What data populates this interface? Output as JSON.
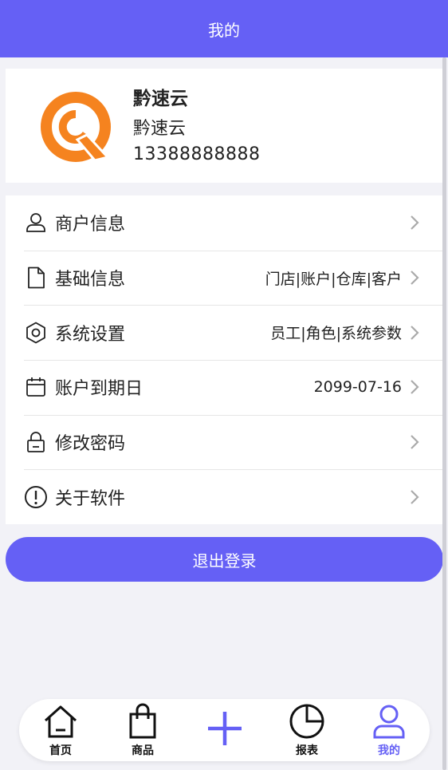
{
  "header": {
    "title": "我的"
  },
  "profile": {
    "name": "黔速云",
    "store": "黔速云",
    "phone": "13388888888"
  },
  "menu": {
    "items": [
      {
        "label": "商户信息",
        "value": "",
        "icon": "user-icon"
      },
      {
        "label": "基础信息",
        "value": "门店|账户|仓库|客户",
        "icon": "document-icon"
      },
      {
        "label": "系统设置",
        "value": "员工|角色|系统参数",
        "icon": "settings-hexagon-icon"
      },
      {
        "label": "账户到期日",
        "value": "2099-07-16",
        "icon": "calendar-icon"
      },
      {
        "label": "修改密码",
        "value": "",
        "icon": "lock-icon"
      },
      {
        "label": "关于软件",
        "value": "",
        "icon": "info-icon"
      }
    ]
  },
  "logout": {
    "label": "退出登录"
  },
  "tabbar": {
    "tabs": [
      {
        "label": "首页",
        "icon": "home-icon"
      },
      {
        "label": "商品",
        "icon": "shopping-bag-icon"
      },
      {
        "label": "",
        "icon": "plus-icon"
      },
      {
        "label": "报表",
        "icon": "pie-chart-icon"
      },
      {
        "label": "我的",
        "icon": "user-icon"
      }
    ],
    "active": "我的"
  },
  "colors": {
    "accent": "#6560f5",
    "avatar": "#f5831f",
    "background": "#f2f2f7"
  }
}
